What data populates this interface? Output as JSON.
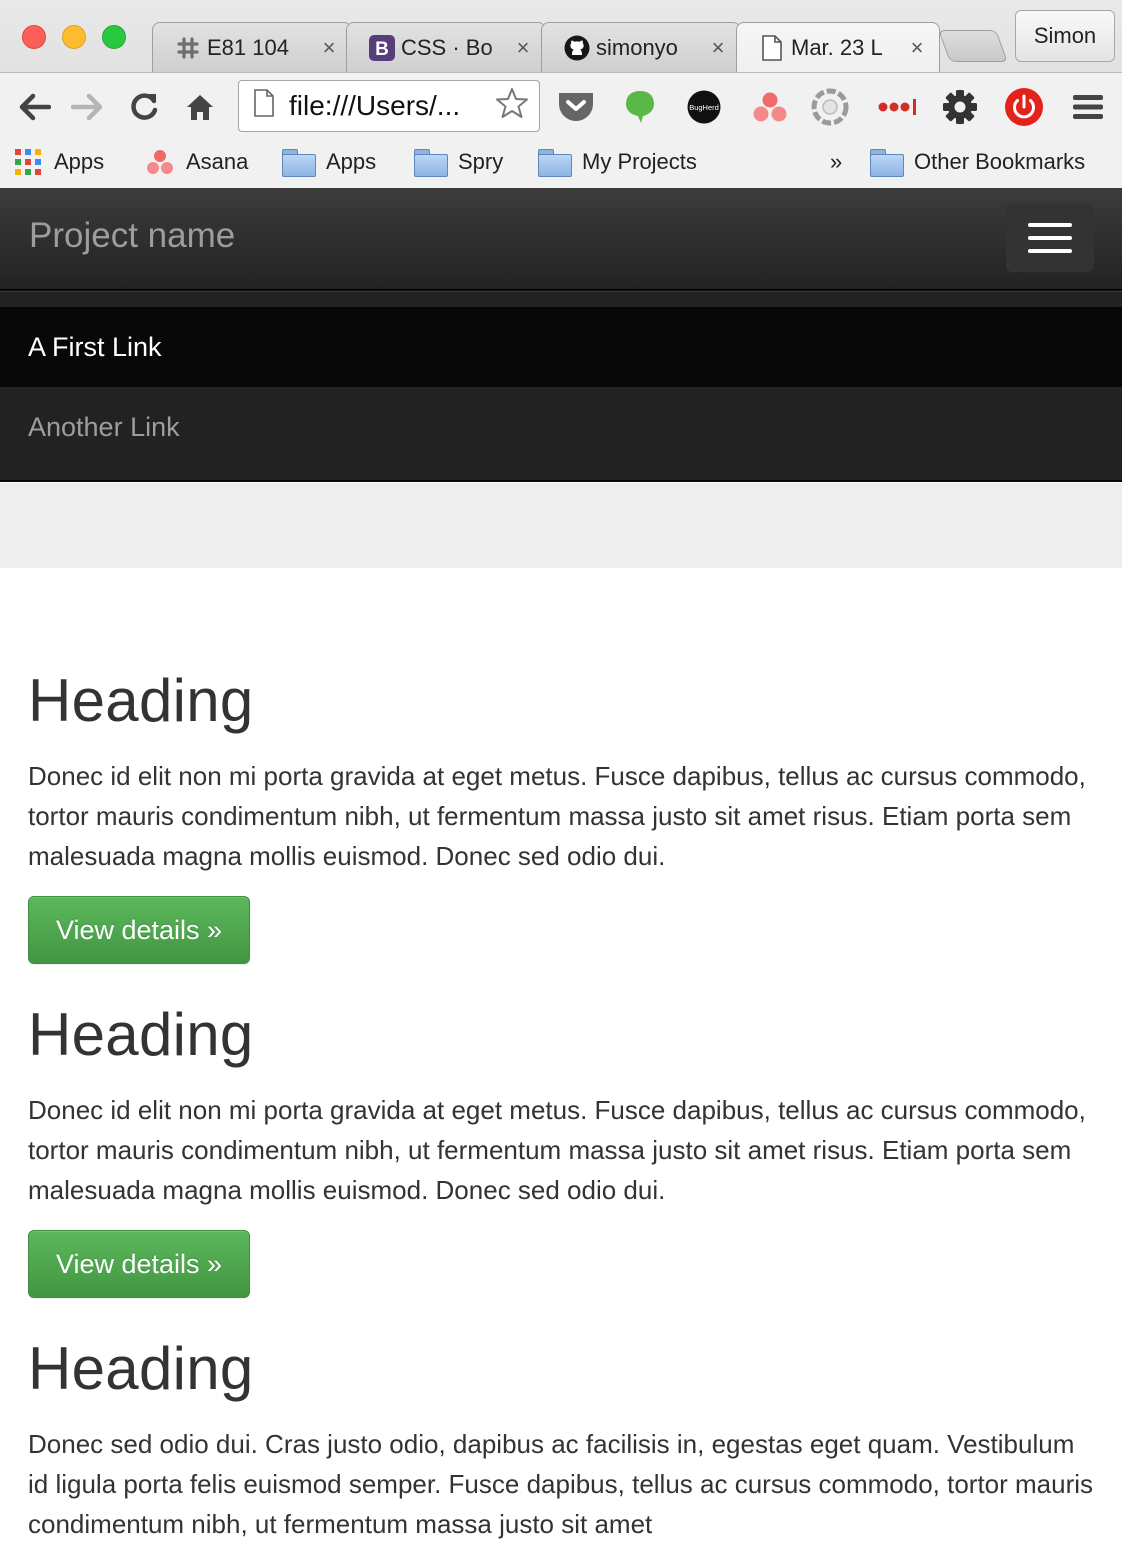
{
  "browser": {
    "tabs": [
      {
        "title": "E81 104",
        "icon": "slack-icon"
      },
      {
        "title": "CSS · Bo",
        "icon": "bootstrap-icon"
      },
      {
        "title": "simonyo",
        "icon": "github-icon"
      },
      {
        "title": "Mar. 23 L",
        "icon": "document-icon",
        "active": true
      }
    ],
    "close_glyph": "×",
    "profile_name": "Simon",
    "url": "file:///Users/...",
    "extensions": [
      "pocket-icon",
      "evernote-icon",
      "bugherd-icon",
      "asana-icon",
      "aperture-icon",
      "lastpass-icon",
      "settings-icon",
      "power-icon"
    ],
    "bugherd_text": "BugHerd",
    "bookmarks": [
      {
        "label": "Apps",
        "icon": "apps-grid-icon"
      },
      {
        "label": "Asana",
        "icon": "asana-icon"
      },
      {
        "label": "Apps",
        "icon": "folder-icon"
      },
      {
        "label": "Spry",
        "icon": "folder-icon"
      },
      {
        "label": "My Projects",
        "icon": "folder-icon"
      }
    ],
    "overflow_glyph": "»",
    "other_bookmarks": "Other Bookmarks"
  },
  "navbar": {
    "brand": "Project name",
    "links": [
      "A First Link",
      "Another Link"
    ]
  },
  "sections": [
    {
      "heading": "Heading",
      "body": "Donec id elit non mi porta gravida at eget metus. Fusce dapibus, tellus ac cursus commodo, tortor mauris condimentum nibh, ut fermentum massa justo sit amet risus. Etiam porta sem malesuada magna mollis euismod. Donec sed odio dui.",
      "button": "View details »"
    },
    {
      "heading": "Heading",
      "body": "Donec id elit non mi porta gravida at eget metus. Fusce dapibus, tellus ac cursus commodo, tortor mauris condimentum nibh, ut fermentum massa justo sit amet risus. Etiam porta sem malesuada magna mollis euismod. Donec sed odio dui.",
      "button": "View details »"
    },
    {
      "heading": "Heading",
      "body": "Donec sed odio dui. Cras justo odio, dapibus ac facilisis in, egestas eget quam. Vestibulum id ligula porta felis euismod semper. Fusce dapibus, tellus ac cursus commodo, tortor mauris condimentum nibh, ut fermentum massa justo sit amet"
    }
  ],
  "colors": {
    "navbar_bg": "#222222",
    "active_link_bg": "#080808",
    "button_green": "#5cb85c",
    "jumbotron_bg": "#eeeeee"
  }
}
